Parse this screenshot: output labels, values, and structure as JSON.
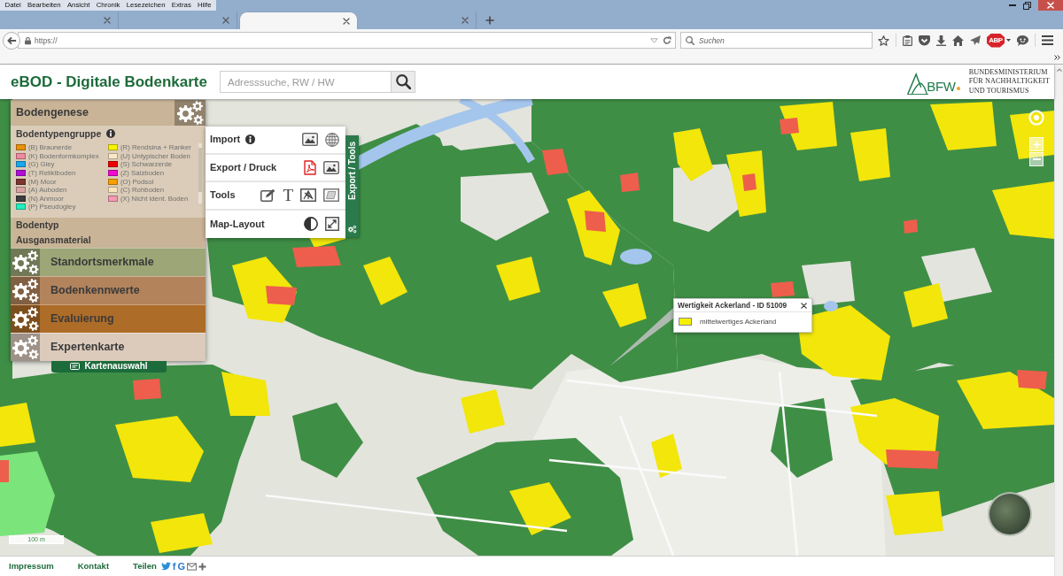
{
  "browser": {
    "menu": [
      "Datei",
      "Bearbeiten",
      "Ansicht",
      "Chronik",
      "Lesezeichen",
      "Extras",
      "Hilfe"
    ],
    "tabs": [
      {
        "selected": false
      },
      {
        "selected": false
      },
      {
        "selected": true
      },
      {
        "selected": false
      }
    ],
    "address": "https://",
    "search": {
      "placeholder": "Suchen"
    },
    "addon_badge": "ABP"
  },
  "header": {
    "title": "eBOD - Digitale Bodenkarte",
    "search": {
      "placeholder": "Adresssuche, RW / HW"
    },
    "logo": "BFW",
    "ministry": [
      "BUNDESMINISTERIUM",
      "FÜR NACHHALTIGKEIT",
      "UND TOURISMUS"
    ]
  },
  "layers": [
    {
      "title": "Bodengenese",
      "color": "#c9b497",
      "expanded": true,
      "groups": [
        {
          "title": "Bodentypengruppe",
          "expanded": true,
          "info": true,
          "legend": [
            {
              "label": "(B) Braunerde",
              "color": "#e8900c"
            },
            {
              "label": "(K) Bodenformkomplex",
              "color": "#ee8aa0"
            },
            {
              "label": "(G) Gley",
              "color": "#19a8ec"
            },
            {
              "label": "(T) Reliktboden",
              "color": "#b00fd8"
            },
            {
              "label": "(M) Moor",
              "color": "#7d3530"
            },
            {
              "label": "(A) Auboden",
              "color": "#d9a3a3"
            },
            {
              "label": "(N) Anmoor",
              "color": "#3c3c3c"
            },
            {
              "label": "(P) Pseudogley",
              "color": "#20f0c0"
            },
            {
              "label": "(R) Rendsina + Ranker",
              "color": "#f8f400"
            },
            {
              "label": "(U) Untypischer Boden",
              "color": "#fbe8c8"
            },
            {
              "label": "(S) Schwarzerde",
              "color": "#f00000"
            },
            {
              "label": "(Z) Salzboden",
              "color": "#f00ad0"
            },
            {
              "label": "(O) Podsol",
              "color": "#f8a000"
            },
            {
              "label": "(C) Rohboden",
              "color": "#fbe6bc"
            },
            {
              "label": "(X) Nicht ident. Boden",
              "color": "#f59ab4"
            }
          ]
        },
        {
          "title": "Bodentyp",
          "expanded": false,
          "info": false
        },
        {
          "title": "Ausgansmaterial",
          "expanded": false,
          "info": false
        }
      ]
    },
    {
      "title": "Standortsmerkmale",
      "color": "#9ca677",
      "expanded": false
    },
    {
      "title": "Bodenkennwerte",
      "color": "#b3845c",
      "expanded": false
    },
    {
      "title": "Evaluierung",
      "color": "#ad6c28",
      "expanded": false
    },
    {
      "title": "Expertenkarte",
      "color": "#dccabb",
      "expanded": false
    }
  ],
  "map_selector": "Kartenauswahl",
  "tools": {
    "tab": "Export / Tools",
    "rows": [
      {
        "label": "Import",
        "info": true,
        "buttons": [
          {
            "kind": "image"
          },
          {
            "kind": "globe"
          }
        ]
      },
      {
        "label": "Export / Druck",
        "info": false,
        "buttons": [
          {
            "kind": "pdf"
          },
          {
            "kind": "image"
          }
        ]
      },
      {
        "label": "Tools",
        "info": false,
        "buttons": [
          {
            "kind": "edit"
          },
          {
            "kind": "glyph",
            "text": "T"
          },
          {
            "kind": "figure"
          },
          {
            "kind": "layer"
          }
        ]
      },
      {
        "label": "Map-Layout",
        "info": false,
        "buttons": [
          {
            "kind": "contrast"
          },
          {
            "kind": "expand"
          }
        ]
      }
    ]
  },
  "popup": {
    "title": "Wertigkeit Ackerland - ID 51009",
    "entries": [
      {
        "label": "mittelwertiges Ackerland",
        "color": "#f5f000"
      }
    ]
  },
  "map": {
    "scale": "100 m"
  },
  "footer": {
    "links": [
      "Impressum",
      "Kontakt"
    ],
    "share": {
      "label": "Teilen",
      "buttons": [
        {
          "kind": "bird"
        },
        {
          "kind": "glyph",
          "text": "f"
        },
        {
          "kind": "glyph",
          "text": "G"
        },
        {
          "kind": "mail"
        },
        {
          "kind": "plus"
        }
      ]
    }
  }
}
